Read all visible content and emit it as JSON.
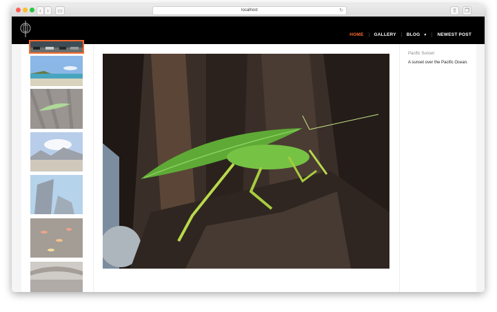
{
  "browser": {
    "address": "localhost",
    "back_icon": "chevron-left-icon",
    "forward_icon": "chevron-right-icon"
  },
  "header": {
    "nav": [
      {
        "label": "HOME",
        "active": true
      },
      {
        "label": "GALLERY",
        "active": false
      },
      {
        "label": "BLOG",
        "active": false,
        "has_dropdown": true
      },
      {
        "label": "NEWEST POST",
        "active": false
      }
    ],
    "accent_color": "#ff6a2e"
  },
  "sidebar": {
    "title": "Pacific Sunset",
    "description": "A sunset over the Pacific Ocean."
  },
  "thumbnails": [
    {
      "name": "cars"
    },
    {
      "name": "beach"
    },
    {
      "name": "katydid"
    },
    {
      "name": "mountains"
    },
    {
      "name": "building"
    },
    {
      "name": "koi-pond"
    },
    {
      "name": "bridge"
    }
  ]
}
